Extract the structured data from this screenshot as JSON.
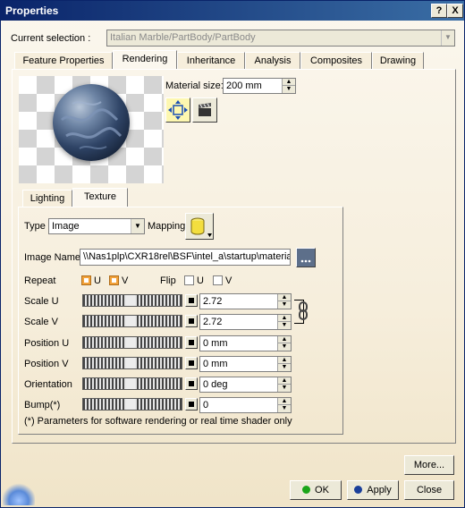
{
  "window": {
    "title": "Properties",
    "help_label": "?",
    "close_label": "X"
  },
  "current_selection": {
    "label": "Current selection :",
    "value": "Italian Marble/PartBody/PartBody"
  },
  "tabs": [
    {
      "label": "Feature Properties"
    },
    {
      "label": "Rendering"
    },
    {
      "label": "Inheritance"
    },
    {
      "label": "Analysis"
    },
    {
      "label": "Composites"
    },
    {
      "label": "Drawing"
    }
  ],
  "active_tab": "Rendering",
  "material": {
    "size_label": "Material size:",
    "size_value": "200 mm"
  },
  "subtabs": [
    {
      "label": "Lighting"
    },
    {
      "label": "Texture"
    }
  ],
  "active_subtab": "Texture",
  "texture": {
    "type_label": "Type",
    "type_value": "Image",
    "mapping_label": "Mapping",
    "image_name_label": "Image Name",
    "image_name_value": "\\\\Nas1plp\\CXR18rel\\BSF\\intel_a\\startup\\materia",
    "repeat_label": "Repeat",
    "repeat_u_label": "U",
    "repeat_v_label": "V",
    "repeat_u_checked": true,
    "repeat_v_checked": true,
    "flip_label": "Flip",
    "flip_u_label": "U",
    "flip_v_label": "V",
    "flip_u_checked": false,
    "flip_v_checked": false,
    "params": [
      {
        "label": "Scale U",
        "value": "2.72"
      },
      {
        "label": "Scale V",
        "value": "2.72"
      },
      {
        "label": "Position U",
        "value": "0 mm"
      },
      {
        "label": "Position V",
        "value": "0 mm"
      },
      {
        "label": "Orientation",
        "value": "0 deg"
      },
      {
        "label": "Bump(*)",
        "value": "0"
      }
    ],
    "footnote": "(*) Parameters for software rendering or real time shader only"
  },
  "buttons": {
    "more": "More...",
    "ok": "OK",
    "apply": "Apply",
    "close": "Close"
  },
  "colors": {
    "title_bar": "#0a246a",
    "ok_dot": "#1aa51a",
    "apply_dot": "#1a3f9a"
  }
}
